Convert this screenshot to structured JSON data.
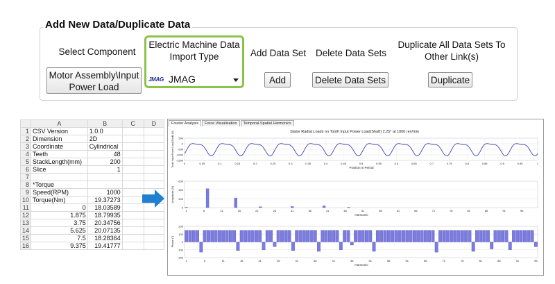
{
  "group": {
    "title": "Add New Data/Duplicate Data",
    "select_component": {
      "label": "Select Component",
      "button": "Motor Assembly\\Input Power Load"
    },
    "import_type": {
      "label": "Electric Machine Data Import Type",
      "logo": "JMAG",
      "value": "JMAG"
    },
    "add_data_set": {
      "label": "Add Data Set",
      "button": "Add"
    },
    "delete_data_sets": {
      "label": "Delete Data Sets",
      "button": "Delete Data Sets"
    },
    "duplicate": {
      "label": "Duplicate All Data Sets To Other Link(s)",
      "button": "Duplicate"
    }
  },
  "spreadsheet": {
    "columns": [
      "A",
      "B",
      "C",
      "D"
    ],
    "rows": [
      {
        "n": "1",
        "a": "CSV Version",
        "b": "1.0.0",
        "b_num": false
      },
      {
        "n": "2",
        "a": "Dimension",
        "b": "2D",
        "b_num": false
      },
      {
        "n": "3",
        "a": "Coordinate",
        "b": "Cylindrical",
        "b_num": false
      },
      {
        "n": "4",
        "a": "Teeth",
        "b": "48",
        "b_num": true
      },
      {
        "n": "5",
        "a": "StackLength(mm)",
        "b": "200",
        "b_num": true
      },
      {
        "n": "6",
        "a": "Slice",
        "b": "1",
        "b_num": true
      },
      {
        "n": "7",
        "a": "",
        "b": "",
        "b_num": true
      },
      {
        "n": "8",
        "a": "*Torque",
        "b": "",
        "b_num": true
      },
      {
        "n": "9",
        "a": "Speed(RPM)",
        "b": "1000",
        "b_num": true
      },
      {
        "n": "10",
        "a": "Torque(Nm)",
        "b": "19.37273",
        "b_num": true
      },
      {
        "n": "11",
        "a": "0",
        "b": "18.03589",
        "b_num": true,
        "a_num": true
      },
      {
        "n": "12",
        "a": "1.875",
        "b": "18.79935",
        "b_num": true,
        "a_num": true
      },
      {
        "n": "13",
        "a": "3.75",
        "b": "20.34756",
        "b_num": true,
        "a_num": true
      },
      {
        "n": "14",
        "a": "5.625",
        "b": "20.07135",
        "b_num": true,
        "a_num": true
      },
      {
        "n": "15",
        "a": "7.5",
        "b": "18.28364",
        "b_num": true,
        "a_num": true
      },
      {
        "n": "16",
        "a": "9.375",
        "b": "19.41777",
        "b_num": true,
        "a_num": true
      }
    ]
  },
  "chart_panel": {
    "tabs": [
      "Fourier Analysis",
      "Force Visualisation",
      "Temporal-Spatial Harmonics"
    ],
    "active_tab": 0,
    "title": "Stator Radial Loads on Tooth Input Power Load(Shaft) 2.25° at 1000 rev/min",
    "accent": "#4040c0"
  },
  "chart_data": [
    {
      "type": "line",
      "title": "Stator Radial Loads on Tooth Input Power Load(Shaft) 2.25° at 1000 rev/min",
      "xlabel": "Position in Period",
      "ylabel": "Tooth Input Power Load(Shaft) (N)",
      "xlim": [
        0,
        1
      ],
      "ylim": [
        -1500,
        500
      ],
      "x_ticks": [
        "0",
        "0.05",
        "0.1",
        "0.15",
        "0.2",
        "0.25",
        "0.3",
        "0.35",
        "0.4",
        "0.45",
        "0.5",
        "0.55",
        "0.6",
        "0.65",
        "0.7",
        "0.75",
        "0.8",
        "0.85",
        "0.9",
        "0.95",
        "1"
      ],
      "y_ticks": [
        "500",
        "0",
        "-500",
        "-1000",
        "-1500"
      ],
      "series": [
        {
          "periods": 12,
          "max": 300,
          "min": -1100
        }
      ],
      "grid": true
    },
    {
      "type": "bar",
      "xlabel": "Harmonic",
      "ylabel": "Amplitude (N)",
      "ylim": [
        0,
        600
      ],
      "y_ticks": [
        "600",
        "400",
        "200",
        "0"
      ],
      "x_ticks": [
        "1",
        "6",
        "11",
        "16",
        "21",
        "26",
        "31",
        "36",
        "41",
        "46",
        "51",
        "56",
        "61",
        "66",
        "71",
        "76",
        "81",
        "86",
        "91",
        "96"
      ],
      "harmonics": [
        1,
        7,
        15,
        22,
        31,
        40,
        47
      ],
      "values": [
        8,
        430,
        220,
        20,
        25,
        40,
        8
      ],
      "grid": true
    },
    {
      "type": "bar",
      "xlabel": "Harmonic",
      "ylabel": "Phase (°)",
      "ylim": [
        -200,
        200
      ],
      "y_ticks": [
        "200",
        "100",
        "0",
        "-100",
        "-200"
      ],
      "x_ticks": [
        "1",
        "6",
        "11",
        "16",
        "21",
        "26",
        "31",
        "36",
        "41",
        "46",
        "51",
        "56",
        "61",
        "66",
        "71",
        "76",
        "81",
        "86",
        "91",
        "96"
      ],
      "values": [
        150,
        150,
        150,
        150,
        -130,
        150,
        150,
        150,
        150,
        150,
        150,
        150,
        150,
        150,
        -110,
        150,
        150,
        150,
        150,
        150,
        150,
        -100,
        150,
        150,
        -60,
        150,
        150,
        150,
        150,
        -110,
        150,
        150,
        150,
        150,
        150,
        150,
        -120,
        150,
        150,
        150,
        150,
        150,
        -100,
        150,
        150,
        -40,
        150,
        150,
        150,
        150,
        150,
        -120,
        150,
        150,
        150,
        150,
        150,
        150,
        150,
        150,
        150,
        150,
        150,
        150,
        150,
        150,
        150,
        150,
        -130,
        150,
        150,
        150,
        150,
        150,
        150,
        150,
        150,
        150,
        -120,
        150,
        150,
        150,
        150,
        -90,
        150,
        150,
        150,
        150,
        -100,
        150,
        150,
        150,
        150,
        150,
        150,
        -60
      ],
      "grid": true
    }
  ]
}
